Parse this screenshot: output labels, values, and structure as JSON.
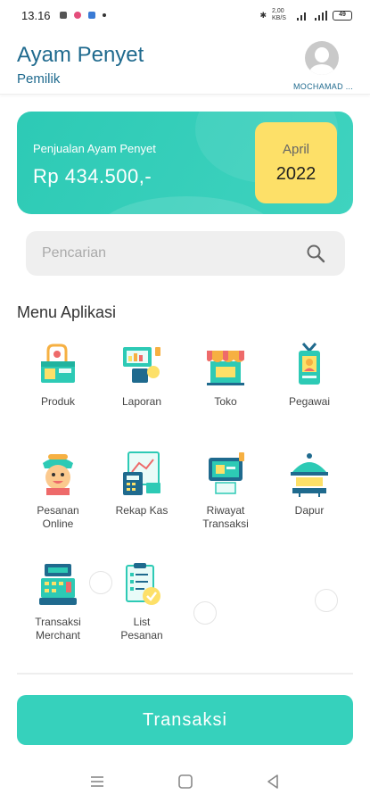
{
  "status_bar": {
    "time": "13.16",
    "net_speed": "2,00 KB/S",
    "battery": "49"
  },
  "header": {
    "title": "Ayam Penyet",
    "subtitle": "Pemilik",
    "username": "MOCHAMAD ..."
  },
  "sales_card": {
    "label": "Penjualan Ayam Penyet",
    "value": "Rp 434.500,-",
    "month": "April",
    "year": "2022",
    "colors": {
      "card": "#2dcab5",
      "month_box": "#fde068"
    }
  },
  "search": {
    "placeholder": "Pencarian",
    "value": ""
  },
  "menu": {
    "title": "Menu Aplikasi",
    "items": [
      {
        "label": "Produk",
        "icon": "produk-icon"
      },
      {
        "label": "Laporan",
        "icon": "laporan-icon"
      },
      {
        "label": "Toko",
        "icon": "toko-icon"
      },
      {
        "label": "Pegawai",
        "icon": "pegawai-icon"
      },
      {
        "label": "Pesanan\nOnline",
        "icon": "pesanan-online-icon"
      },
      {
        "label": "Rekap Kas",
        "icon": "rekap-kas-icon"
      },
      {
        "label": "Riwayat\nTransaksi",
        "icon": "riwayat-transaksi-icon"
      },
      {
        "label": "Dapur",
        "icon": "dapur-icon"
      },
      {
        "label": "Transaksi\nMerchant",
        "icon": "transaksi-merchant-icon"
      },
      {
        "label": "List\nPesanan",
        "icon": "list-pesanan-icon"
      }
    ]
  },
  "primary_button": {
    "label": "Transaksi",
    "color": "#36d1bc"
  },
  "navbar": {
    "icons": [
      "menu-icon",
      "home-square-icon",
      "back-triangle-icon"
    ]
  }
}
